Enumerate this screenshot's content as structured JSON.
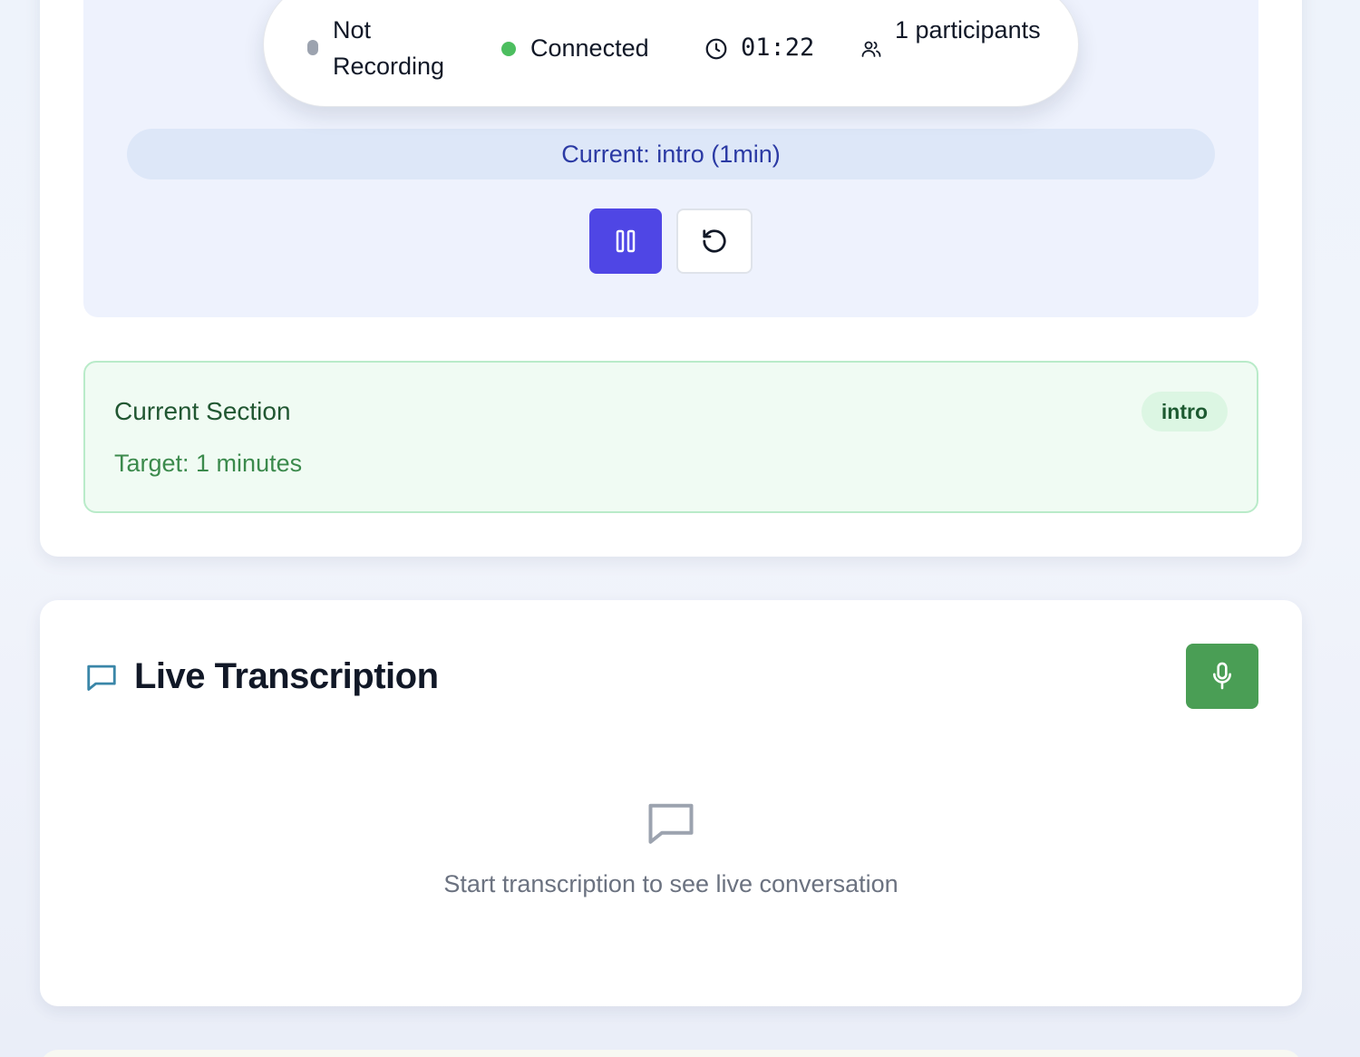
{
  "status_bar": {
    "recording_status": "Not Recording",
    "connection_status": "Connected",
    "elapsed_time": "01:22",
    "participants": "1 participants",
    "colors": {
      "recording_dot": "#9ca3af",
      "connected_dot": "#4cbe5f"
    }
  },
  "timer": {
    "current_label": "Current: intro (1min)",
    "icons": {
      "pause": "pause-icon",
      "reset": "rotate-ccw-icon"
    },
    "accent_color": "#4f46e5"
  },
  "current_section": {
    "title": "Current Section",
    "target": "Target: 1 minutes",
    "badge": "intro"
  },
  "transcription": {
    "title": "Live Transcription",
    "empty_message": "Start transcription to see live conversation",
    "icons": {
      "header": "message-square-icon",
      "mic": "microphone-icon",
      "empty": "message-square-icon"
    },
    "mic_color": "#4a9e55"
  }
}
